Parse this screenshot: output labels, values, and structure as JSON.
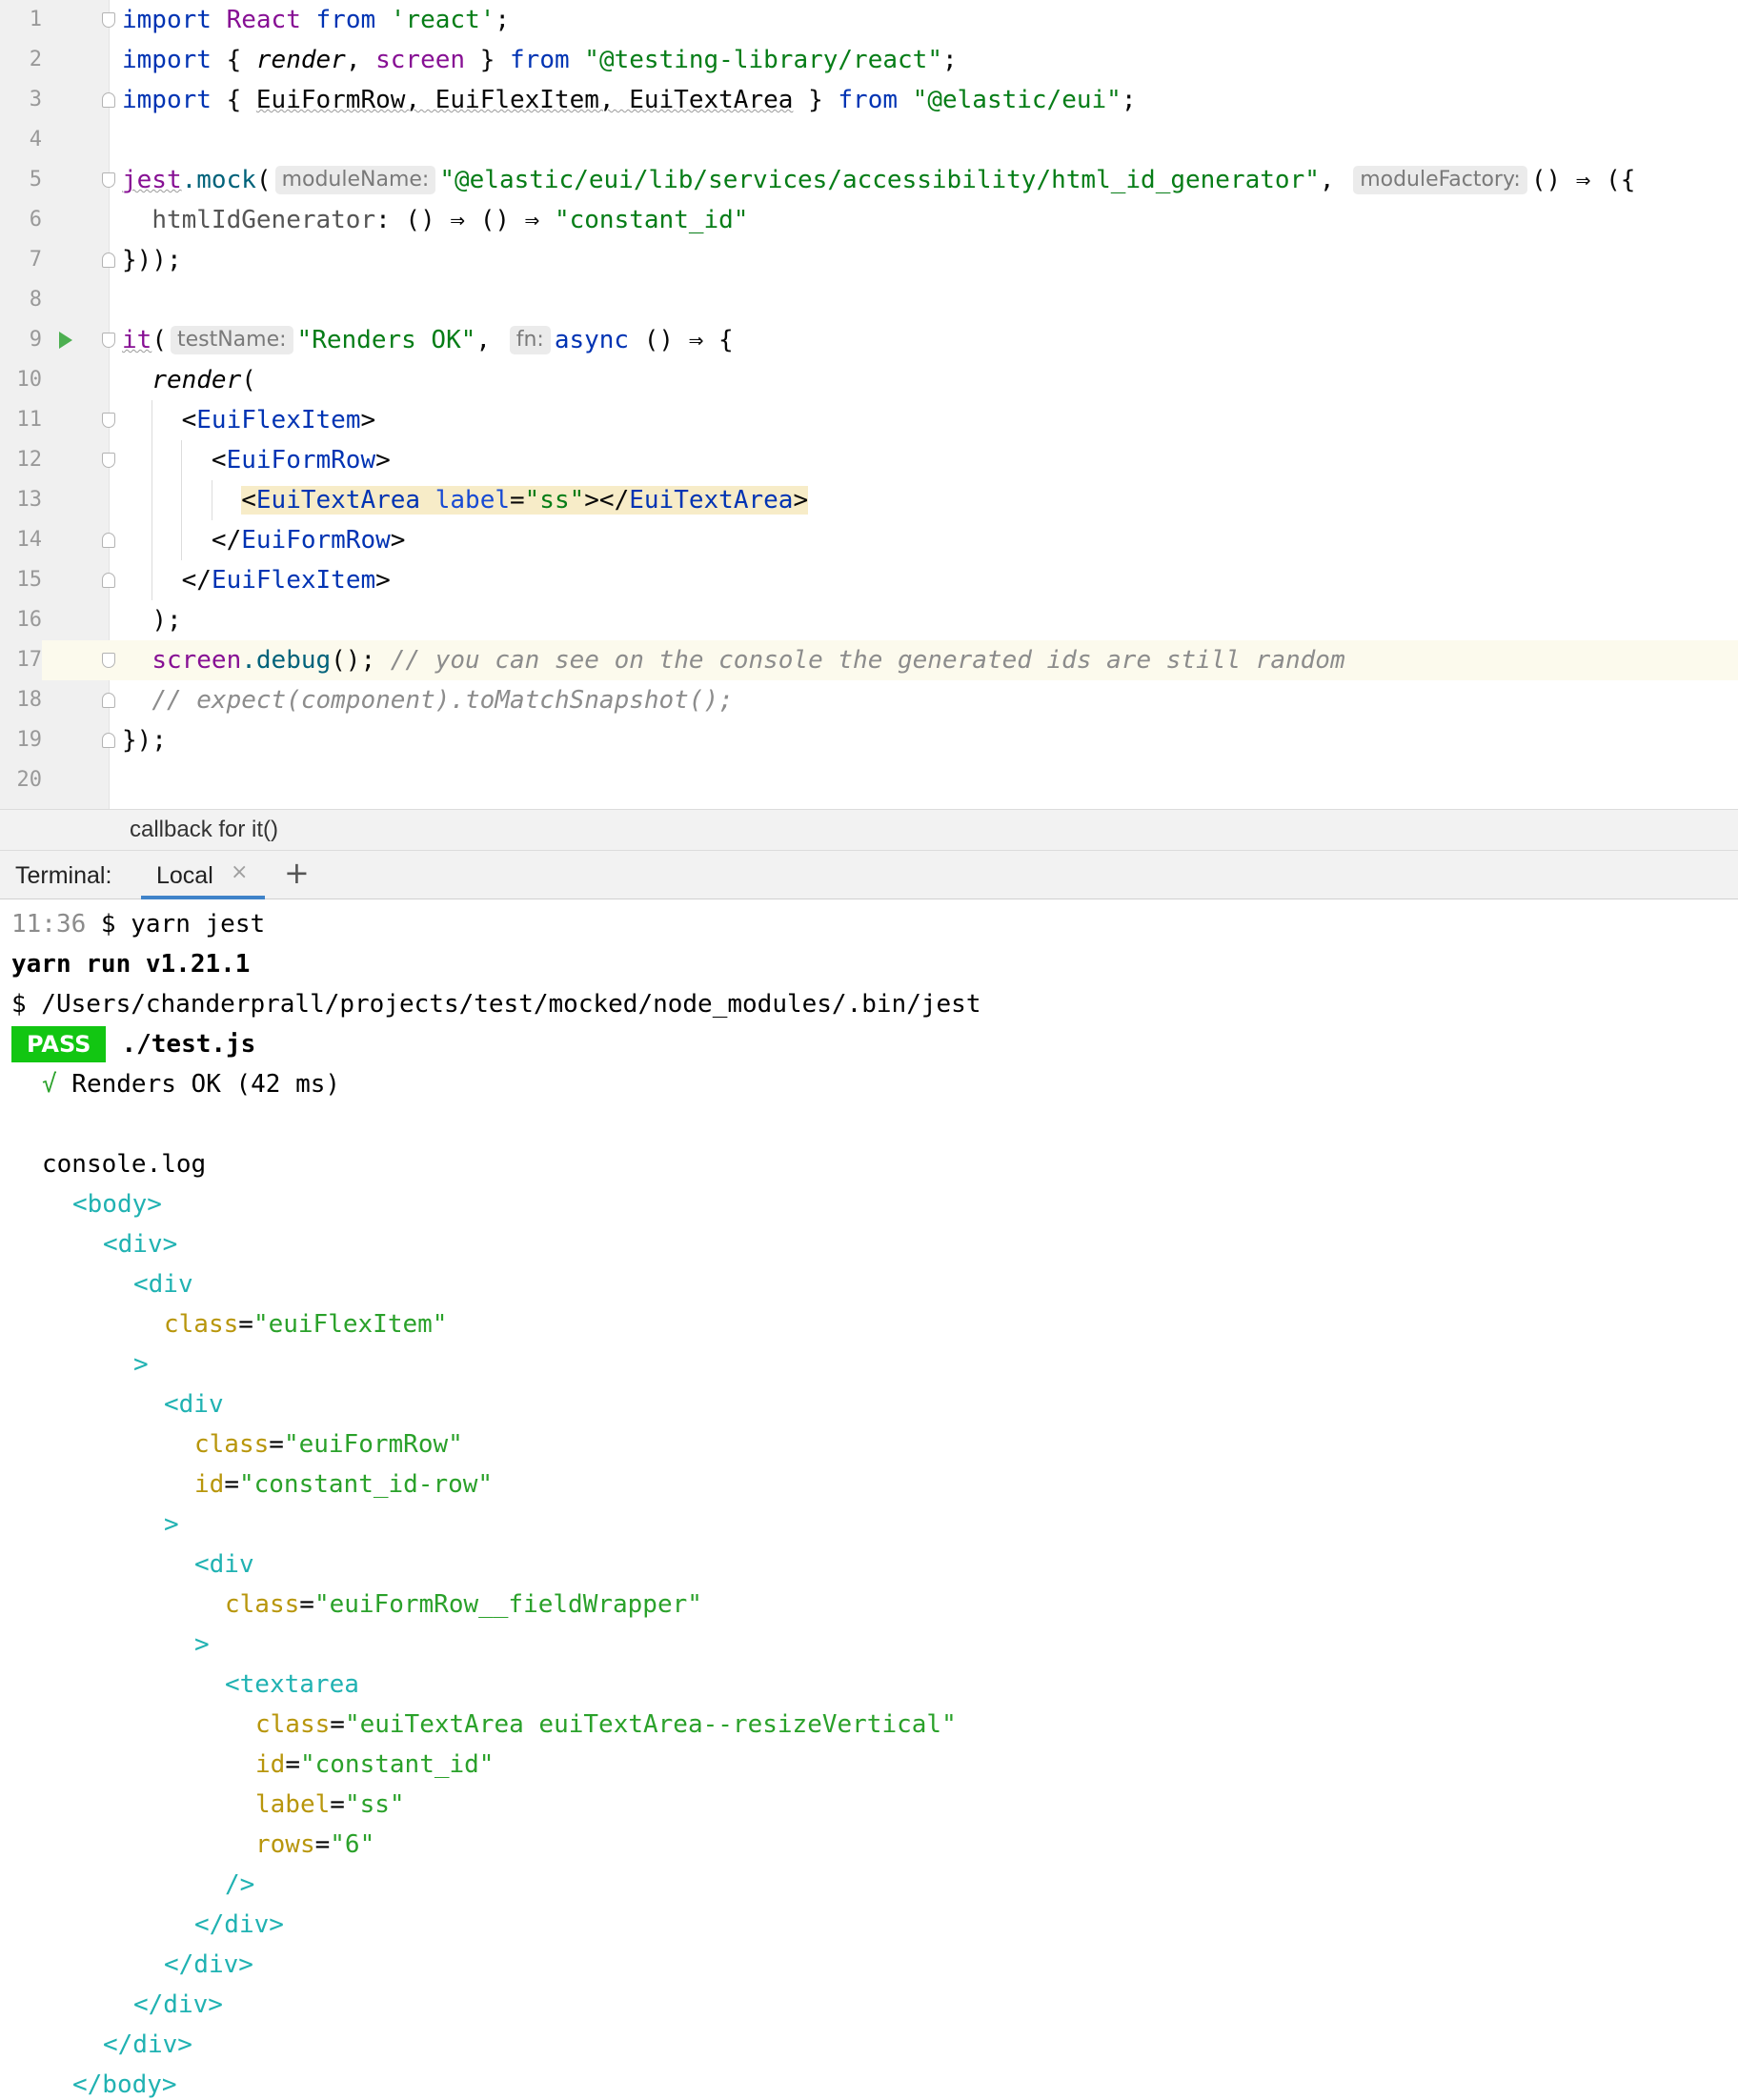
{
  "editor": {
    "line_numbers": [
      "1",
      "2",
      "3",
      "4",
      "5",
      "6",
      "7",
      "8",
      "9",
      "10",
      "11",
      "12",
      "13",
      "14",
      "15",
      "16",
      "17",
      "18",
      "19",
      "20"
    ],
    "l1": {
      "kw_import": "import",
      "react": "React",
      "from": "from",
      "path": "'react'",
      "semi": ";"
    },
    "l2": {
      "kw_import": "import",
      "open": "{ ",
      "render": "render",
      "comma": ", ",
      "screen": "screen",
      "close": " } ",
      "from": "from",
      "path": "\"@testing-library/react\"",
      "semi": ";"
    },
    "l3": {
      "kw_import": "import",
      "open": "{ ",
      "names": "EuiFormRow, EuiFlexItem, EuiTextArea",
      "close": " } ",
      "from": "from",
      "path": "\"@elastic/eui\"",
      "semi": ";"
    },
    "l5": {
      "jest": "jest",
      "dot_mock": ".mock",
      "paren": "(",
      "hint_module": "moduleName:",
      "path": "\"@elastic/eui/lib/services/accessibility/html_id_generator\"",
      "comma": ",",
      "hint_factory": "moduleFactory:",
      "tail": "() ⇒ ({"
    },
    "l6": {
      "prop": "htmlIdGenerator",
      "mid": ": () ⇒ () ⇒ ",
      "value": "\"constant_id\""
    },
    "l7": {
      "text": "}));"
    },
    "l9": {
      "it": "it",
      "paren": "(",
      "hint_test": "testName:",
      "name": "\"Renders OK\"",
      "comma": ",",
      "hint_fn": "fn:",
      "async": "async",
      "tail": " () ⇒ {"
    },
    "l10": {
      "render": "render",
      "paren": "("
    },
    "l11": {
      "lt": "<",
      "tag": "EuiFlexItem",
      "gt": ">"
    },
    "l12": {
      "lt": "<",
      "tag": "EuiFormRow",
      "gt": ">"
    },
    "l13": {
      "lt": "<",
      "tag": "EuiTextArea",
      "attr": " label",
      "eq": "=",
      "value": "\"ss\"",
      "mid": "></",
      "endtag": "EuiTextArea",
      "gt": ">"
    },
    "l14": {
      "lt": "</",
      "tag": "EuiFormRow",
      "gt": ">"
    },
    "l15": {
      "lt": "</",
      "tag": "EuiFlexItem",
      "gt": ">"
    },
    "l16": {
      "text": ");"
    },
    "l17": {
      "screen": "screen",
      "debug": ".debug",
      "rest": "(); ",
      "comment": "// you can see on the console the generated ids are still random"
    },
    "l18": {
      "comment": "// expect(component).toMatchSnapshot();"
    },
    "l19": {
      "text": "});"
    }
  },
  "breadcrumb": "callback for it()",
  "terminal_tabs": {
    "label": "Terminal:",
    "local": "Local",
    "close": "×",
    "add": "+"
  },
  "terminal": {
    "prompt_time": "11:36",
    "prompt_cmd": " $ yarn jest",
    "yarn_run": "yarn run v1.21.1",
    "bin_path": "$ /Users/chanderprall/projects/test/mocked/node_modules/.bin/jest",
    "pass_badge": "PASS",
    "test_file": "./test.js",
    "check": "√",
    "test_result": " Renders OK (42 ms)",
    "console_log": "console.log",
    "body_open": "<body>",
    "div_open": "<div>",
    "div_start": "<div",
    "attr_class": "class",
    "attr_id": "id",
    "attr_label": "label",
    "attr_rows": "rows",
    "eq": "=",
    "val_flexitem": "\"euiFlexItem\"",
    "val_formrow": "\"euiFormRow\"",
    "val_rowid": "\"constant_id-row\"",
    "val_fieldwrapper": "\"euiFormRow__fieldWrapper\"",
    "textarea_start": "<textarea",
    "val_textarea_class": "\"euiTextArea euiTextArea--resizeVertical\"",
    "val_textarea_id": "\"constant_id\"",
    "val_label": "\"ss\"",
    "val_rows": "\"6\"",
    "gt": ">",
    "self_close": "/>",
    "div_close": "</div>",
    "body_close": "</body>"
  }
}
